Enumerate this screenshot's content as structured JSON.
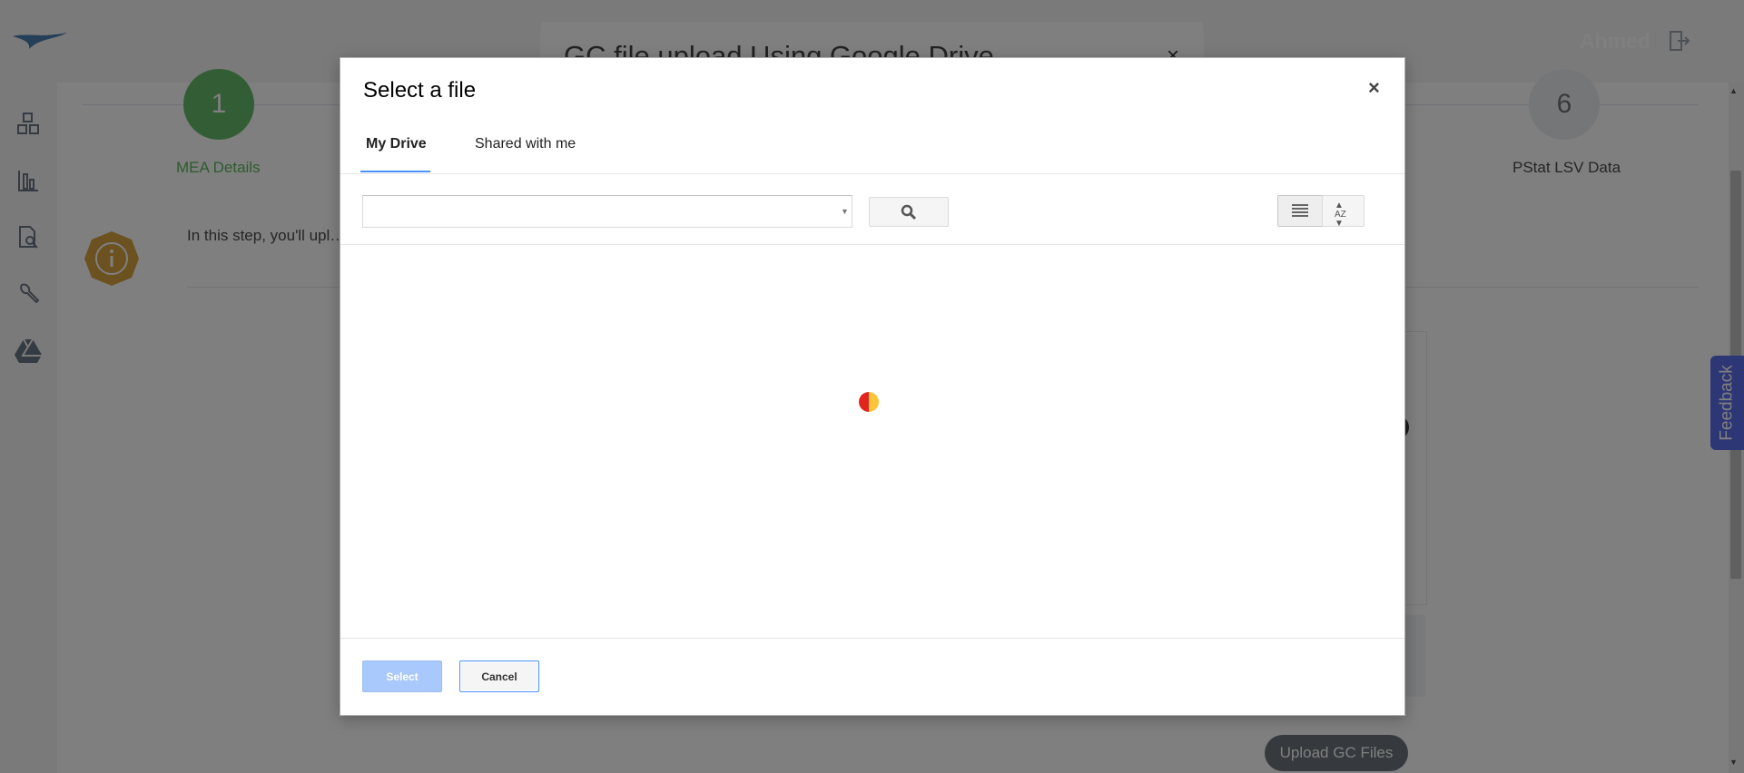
{
  "app": {
    "user_name": "Ahmed",
    "icons": {
      "logo": "bird-logo-icon",
      "logout": "logout-icon",
      "sidebar": [
        "dashboard-icon",
        "chart-icon",
        "file-search-icon",
        "wrench-icon",
        "google-drive-icon"
      ]
    },
    "steps": [
      {
        "number": "1",
        "label": "MEA Details",
        "status": "complete"
      },
      {
        "number": "6",
        "label": "PStat LSV Data",
        "status": "pending"
      }
    ],
    "info_text": "In this step, you'll upl…ovided in the required format to ensure accurate integration a…",
    "upload_button_label": "Upload GC Files",
    "feedback_label": "Feedback",
    "colors": {
      "step_complete": "#66bb6a",
      "accent_blue": "#4d90fe",
      "feedback": "#5b6eea"
    }
  },
  "background_modal": {
    "title": "GC file upload Using Google Drive",
    "close_label": "×"
  },
  "picker": {
    "title": "Select a file",
    "close_label": "×",
    "tabs": [
      {
        "label": "My Drive",
        "active": true
      },
      {
        "label": "Shared with me",
        "active": false
      }
    ],
    "search": {
      "value": "",
      "placeholder": ""
    },
    "sort_label": "AZ",
    "loading": true,
    "buttons": {
      "select": "Select",
      "cancel": "Cancel"
    }
  }
}
